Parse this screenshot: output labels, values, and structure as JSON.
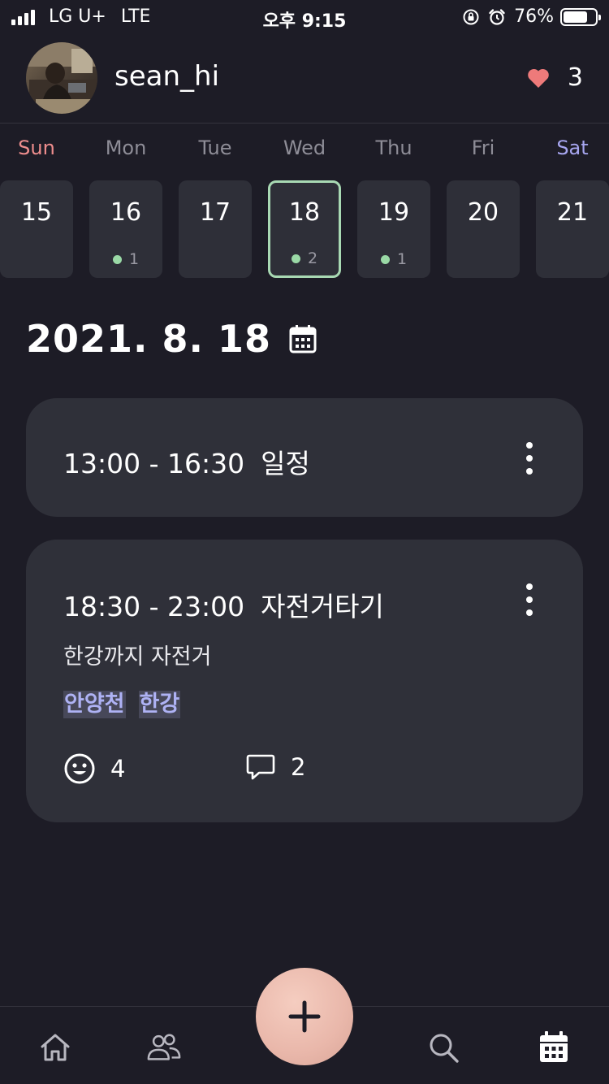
{
  "status_bar": {
    "carrier": "LG U+",
    "network": "LTE",
    "time": "오후 9:15",
    "battery_percent": "76%",
    "battery_level": 0.76,
    "icons": [
      "signal-icon",
      "orientation-lock-icon",
      "alarm-icon",
      "battery-icon"
    ]
  },
  "header": {
    "username": "sean_hi",
    "likes_count": "3",
    "avatar_icon": "user-photo",
    "heart_icon": "heart-icon"
  },
  "week": {
    "weekdays": [
      "Sun",
      "Mon",
      "Tue",
      "Wed",
      "Thu",
      "Fri",
      "Sat"
    ],
    "days": [
      {
        "num": "15",
        "count": ""
      },
      {
        "num": "16",
        "count": "1"
      },
      {
        "num": "17",
        "count": ""
      },
      {
        "num": "18",
        "count": "2"
      },
      {
        "num": "19",
        "count": "1"
      },
      {
        "num": "20",
        "count": ""
      },
      {
        "num": "21",
        "count": ""
      }
    ],
    "selected_day": "18"
  },
  "date_heading": "2021. 8. 18",
  "events": [
    {
      "time": "13:00 - 16:30",
      "title": "일정"
    },
    {
      "time": "18:30 - 23:00",
      "title": "자전거타기",
      "description": "한강까지 자전거",
      "tags": [
        "안양천",
        "한강"
      ],
      "reactions": "4",
      "comments": "2"
    }
  ],
  "bottom_nav": [
    "home-icon",
    "friends-icon",
    "add-icon",
    "search-icon",
    "calendar-icon"
  ],
  "colors": {
    "background": "#1d1c26",
    "card": "#2f3039",
    "accent_green": "#a8d9b3",
    "sunday": "#ee8d8d",
    "saturday": "#a7a6f0",
    "tag": "#aeb2f4",
    "heart": "#ee7a7a",
    "fab": "#e9b7aa"
  }
}
